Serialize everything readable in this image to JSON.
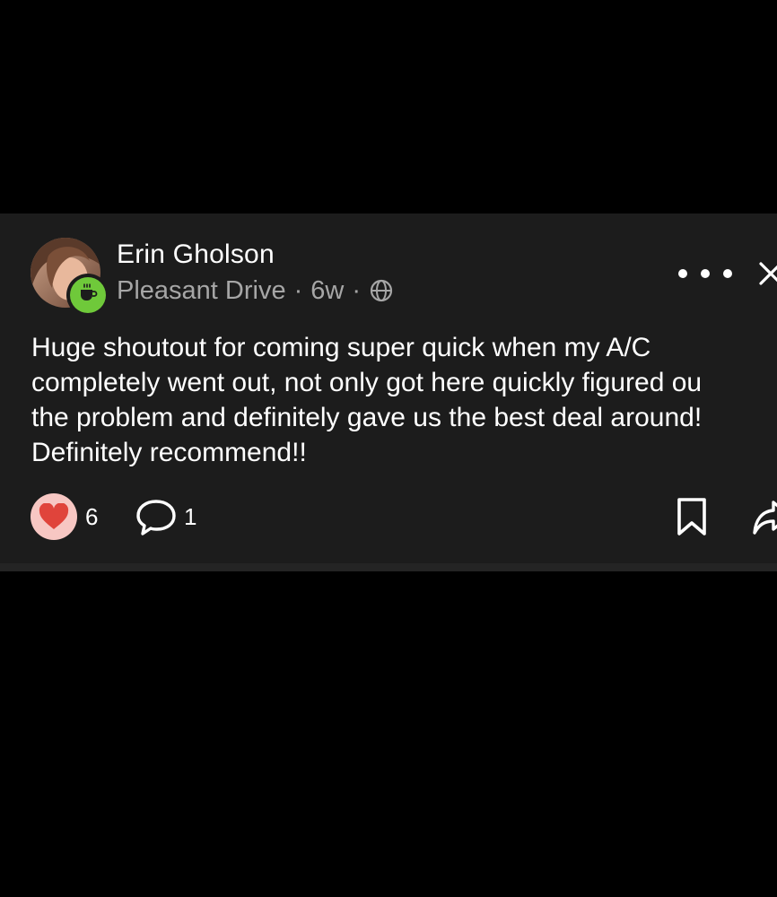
{
  "post": {
    "author": "Erin Gholson",
    "neighborhood": "Pleasant Drive",
    "separator": "·",
    "time_ago": "6w",
    "body_lines": [
      "Huge shoutout for coming super quick when my A/C",
      "completely went out, not only got here quickly figured ou",
      "the problem and definitely gave us the best deal around!",
      "Definitely recommend!!"
    ],
    "reaction_count": "6",
    "comment_count": "1"
  },
  "icons": {
    "badge": "coffee-cup-icon",
    "audience": "globe-icon",
    "more": "more-dots-icon",
    "close": "close-icon",
    "reaction": "heart-icon",
    "comment": "comment-bubble-icon",
    "bookmark": "bookmark-icon",
    "share": "share-arrow-icon"
  },
  "colors": {
    "background": "#000000",
    "card": "#1c1c1c",
    "meta_text": "#a6a6a6",
    "badge_green": "#6fc93a",
    "heart_red": "#e0443b",
    "heart_bubble": "#f7c7c3"
  }
}
